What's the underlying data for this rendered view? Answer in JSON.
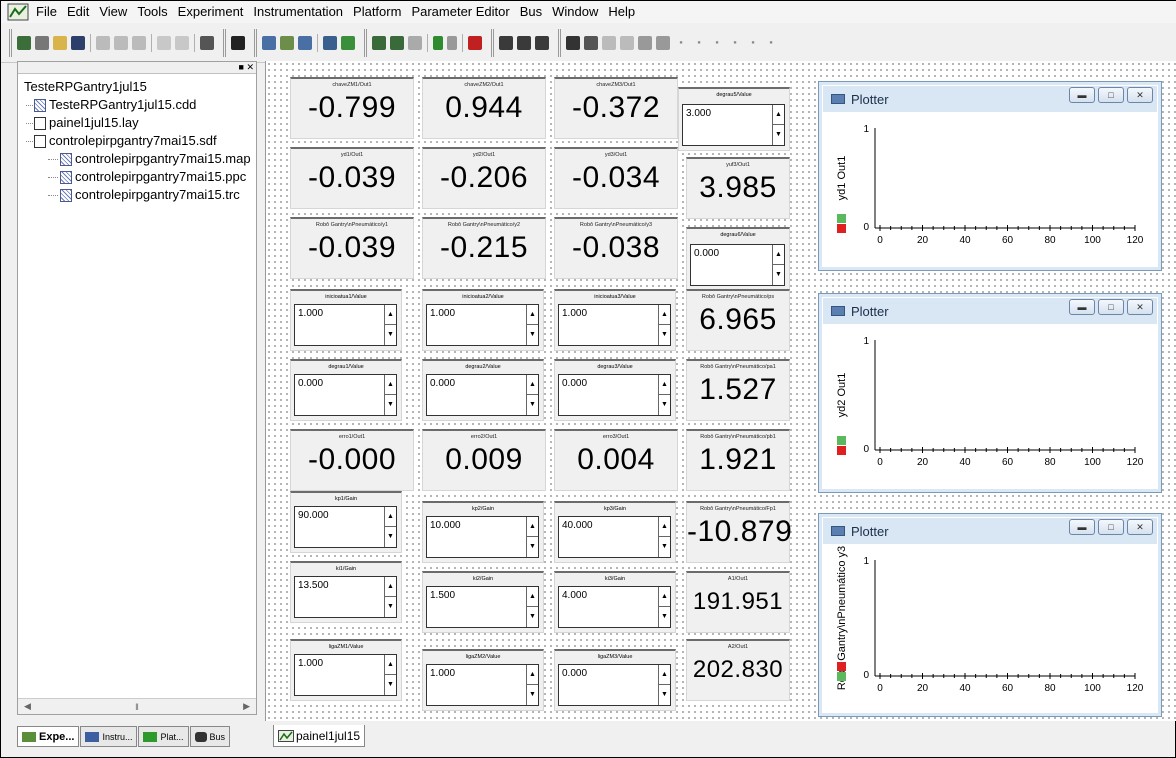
{
  "menu": [
    "File",
    "Edit",
    "View",
    "Tools",
    "Experiment",
    "Instrumentation",
    "Platform",
    "Parameter Editor",
    "Bus",
    "Window",
    "Help"
  ],
  "tree": {
    "root": "TesteRPGantry1jul15",
    "items": [
      {
        "label": "TesteRPGantry1jul15.cdd",
        "level": 1,
        "icon": "cdd-file-icon"
      },
      {
        "label": "painel1jul15.lay",
        "level": 1,
        "icon": "document-icon"
      },
      {
        "label": "controlepirpgantry7mai15.sdf",
        "level": 1,
        "icon": "document-icon"
      },
      {
        "label": "controlepirpgantry7mai15.map",
        "level": 2,
        "icon": "cdd-file-icon"
      },
      {
        "label": "controlepirpgantry7mai15.ppc",
        "level": 2,
        "icon": "cdd-file-icon"
      },
      {
        "label": "controlepirpgantry7mai15.trc",
        "level": 2,
        "icon": "cdd-file-icon"
      }
    ]
  },
  "left_tabs": [
    "Expe...",
    "Instru...",
    "Plat...",
    "Bus"
  ],
  "layout_tab": "painel1jul15",
  "displays": {
    "chaveZM1": {
      "label": "chaveZM1/Out1",
      "value": "-0.799"
    },
    "chaveZM2": {
      "label": "chaveZM2/Out1",
      "value": "0.944"
    },
    "chaveZM3": {
      "label": "chaveZM3/Out1",
      "value": "-0.372"
    },
    "yd1": {
      "label": "yd1/Out1",
      "value": "-0.039"
    },
    "yd2": {
      "label": "yd2/Out1",
      "value": "-0.206"
    },
    "yd3": {
      "label": "yd3/Out1",
      "value": "-0.034"
    },
    "yuf3": {
      "label": "yuf3/Out1",
      "value": "3.985"
    },
    "y1": {
      "label": "Robô Gantry\\nPneumático/y1",
      "value": "-0.039"
    },
    "y2": {
      "label": "Robô Gantry\\nPneumático/y2",
      "value": "-0.215"
    },
    "y3": {
      "label": "Robô Gantry\\nPneumático/y3",
      "value": "-0.038"
    },
    "ps": {
      "label": "Robô Gantry\\nPneumático/ps",
      "value": "6.965"
    },
    "pa1": {
      "label": "Robô Gantry\\nPneumático/pa1",
      "value": "1.527"
    },
    "erro1": {
      "label": "erro1/Out1",
      "value": "-0.000"
    },
    "erro2": {
      "label": "erro2/Out1",
      "value": "0.009"
    },
    "erro3": {
      "label": "erro3/Out1",
      "value": "0.004"
    },
    "pb1": {
      "label": "Robô Gantry\\nPneumático/pb1",
      "value": "1.921"
    },
    "fp1": {
      "label": "Robô Gantry\\nPneumático/Fp1",
      "value": "-10.879"
    },
    "a1": {
      "label": "A1/Out1",
      "value": "191.951"
    },
    "a2": {
      "label": "A2/Out1",
      "value": "202.830"
    }
  },
  "inputs": {
    "degrau5": {
      "label": "degrau5/Value",
      "value": "3.000"
    },
    "degrau6": {
      "label": "degrau6/Value",
      "value": "0.000"
    },
    "inicioatua1": {
      "label": "inicioatua1/Value",
      "value": "1.000"
    },
    "inicioatua2": {
      "label": "inicioatua2/Value",
      "value": "1.000"
    },
    "inicioatua3": {
      "label": "inicioatua3/Value",
      "value": "1.000"
    },
    "degrau1": {
      "label": "degrau1/Value",
      "value": "0.000"
    },
    "degrau2": {
      "label": "degrau2/Value",
      "value": "0.000"
    },
    "degrau3": {
      "label": "degrau3/Value",
      "value": "0.000"
    },
    "kp1": {
      "label": "kp1/Gain",
      "value": "90.000"
    },
    "kp2": {
      "label": "kp2/Gain",
      "value": "10.000"
    },
    "kp3": {
      "label": "kp3/Gain",
      "value": "40.000"
    },
    "ki1": {
      "label": "ki1/Gain",
      "value": "13.500"
    },
    "ki2": {
      "label": "ki2/Gain",
      "value": "1.500"
    },
    "ki3": {
      "label": "ki3/Gain",
      "value": "4.000"
    },
    "ligaZM1": {
      "label": "ligaZM1/Value",
      "value": "1.000"
    },
    "ligaZM2": {
      "label": "ligaZM2/Value",
      "value": "1.000"
    },
    "ligaZM3": {
      "label": "ligaZM3/Value",
      "value": "0.000"
    }
  },
  "plotters": [
    {
      "title": "Plotter",
      "ylabel": "yd1 Out1",
      "xticks": [
        "0",
        "20",
        "40",
        "60",
        "80",
        "100",
        "120"
      ],
      "ytop": "1",
      "ybottom": "0"
    },
    {
      "title": "Plotter",
      "ylabel": "yd2 Out1",
      "xticks": [
        "0",
        "20",
        "40",
        "60",
        "80",
        "100",
        "120"
      ],
      "ytop": "1",
      "ybottom": "0"
    },
    {
      "title": "Plotter",
      "ylabel": "Robô Gantry\\nPneumático y3",
      "xticks": [
        "0",
        "20",
        "40",
        "60",
        "80",
        "100",
        "120"
      ],
      "ytop": "1",
      "ybottom": "0"
    }
  ],
  "colors": {
    "accent_green": "#5cb85c",
    "accent_red": "#e02020",
    "plot_border": "#7a9ab8"
  }
}
